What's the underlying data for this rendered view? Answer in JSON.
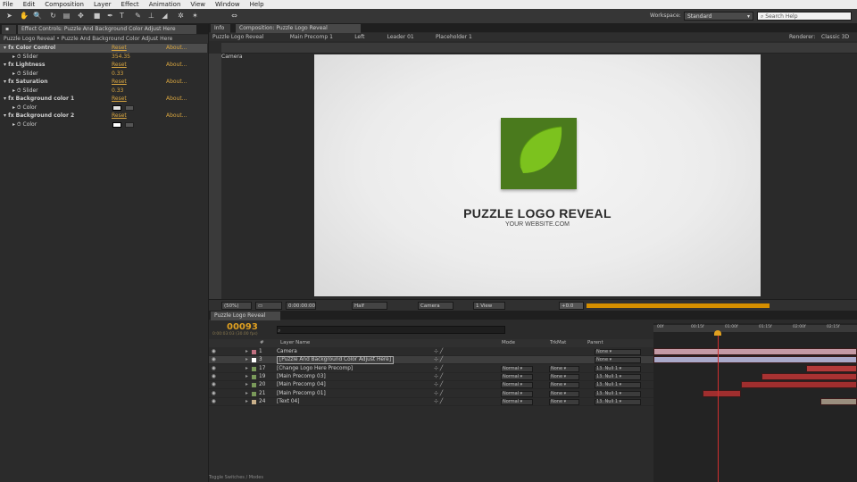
{
  "menu": [
    "File",
    "Edit",
    "Composition",
    "Layer",
    "Effect",
    "Animation",
    "View",
    "Window",
    "Help"
  ],
  "toolbar": {
    "workspace_label": "Workspace:",
    "workspace_value": "Standard",
    "search_placeholder": "Search Help"
  },
  "effect_controls": {
    "tab_label": "Effect Controls: Puzzle And Background Color Adjust Here",
    "project_tab": "Project",
    "breadcrumb": "Puzzle Logo Reveal • Puzzle And Background Color Adjust Here",
    "rows": [
      {
        "label": "Color Control",
        "reset": "Reset",
        "about": "About...",
        "type": "effect",
        "selected": true
      },
      {
        "label": "Slider",
        "value": "354.35",
        "type": "param"
      },
      {
        "label": "Lightness",
        "reset": "Reset",
        "about": "About...",
        "type": "effect"
      },
      {
        "label": "Slider",
        "value": "0.33",
        "type": "param"
      },
      {
        "label": "Saturation",
        "reset": "Reset",
        "about": "About...",
        "type": "effect"
      },
      {
        "label": "Slider",
        "value": "0.33",
        "type": "param"
      },
      {
        "label": "Background color 1",
        "reset": "Reset",
        "about": "About...",
        "type": "effect"
      },
      {
        "label": "Color",
        "color": "#e0e0e0",
        "type": "color"
      },
      {
        "label": "Background color 2",
        "reset": "Reset",
        "about": "About...",
        "type": "effect"
      },
      {
        "label": "Color",
        "color": "#ffffff",
        "type": "color"
      }
    ]
  },
  "composition": {
    "tab_left": "Info",
    "tab_label": "Composition: Puzzle Logo Reveal",
    "subtabs": [
      "Puzzle Logo Reveal",
      "Main Precomp 1",
      "Left",
      "Leader 01",
      "Placeholder 1"
    ],
    "renderer_label": "Renderer:",
    "renderer_value": "Classic 3D",
    "camera_label": "Camera",
    "logo_title": "PUZZLE LOGO REVEAL",
    "logo_subtitle": "YOUR WEBSITE.COM",
    "logo_color": "#4a7a1d",
    "leaf_color": "#7cc21e",
    "viewbar": {
      "zoom": "(50%)",
      "timecode": "0:00:00:00",
      "resolution": "Half",
      "view": "Camera",
      "views": "1 View",
      "exposure": "+0.0"
    }
  },
  "timeline": {
    "tab_label": "Puzzle Logo Reveal",
    "timecode": "00093",
    "timecode_sub": "0:00:03:03 (30.00 fps)",
    "search_placeholder": "",
    "columns": {
      "number": "#",
      "name": "Layer Name",
      "mode": "Mode",
      "trkmat": "TrkMat",
      "parent": "Parent"
    },
    "ruler_ticks": [
      "00f",
      "00:15f",
      "01:00f",
      "01:15f",
      "02:00f",
      "02:15f"
    ],
    "playhead_value": "00093",
    "layers": [
      {
        "num": "1",
        "name": "Camera",
        "label_color": "#c07080",
        "mode": "",
        "trkmat": "",
        "parent": "None",
        "bar_color": "#c49aa5",
        "start": 0.0,
        "end": 1.0
      },
      {
        "num": "3",
        "name": "[Puzzle And Background Color Adjust Here]",
        "label_color": "#ffffff",
        "mode": "",
        "trkmat": "",
        "parent": "None",
        "bar_color": "#a9a9c9",
        "start": 0.0,
        "end": 1.0,
        "selected": true
      },
      {
        "num": "17",
        "name": "[Change Logo Here Precomp]",
        "label_color": "#7a9a5a",
        "mode": "Normal",
        "trkmat": "None",
        "parent": "13. Null 1",
        "bar_color": "#b33a3a",
        "start": 0.75,
        "end": 1.0
      },
      {
        "num": "19",
        "name": "[Main Precomp 03]",
        "label_color": "#7a9a5a",
        "mode": "Normal",
        "trkmat": "None",
        "parent": "13. Null 1",
        "bar_color": "#a83232",
        "start": 0.53,
        "end": 1.0
      },
      {
        "num": "20",
        "name": "[Main Precomp 04]",
        "label_color": "#7a9a5a",
        "mode": "Normal",
        "trkmat": "None",
        "parent": "13. Null 1",
        "bar_color": "#a02e2e",
        "start": 0.43,
        "end": 1.0
      },
      {
        "num": "21",
        "name": "[Main Precomp 01]",
        "label_color": "#7a9a5a",
        "mode": "Normal",
        "trkmat": "None",
        "parent": "13. Null 1",
        "bar_color": "#a02e2e",
        "start": 0.24,
        "end": 0.43
      },
      {
        "num": "24",
        "name": "[Text 04]",
        "label_color": "#c9b08a",
        "mode": "Normal",
        "trkmat": "None",
        "parent": "13. Null 1",
        "bar_color": "#9a8e7e",
        "start": 0.82,
        "end": 1.0
      }
    ],
    "footer": "Toggle Switches / Modes"
  }
}
